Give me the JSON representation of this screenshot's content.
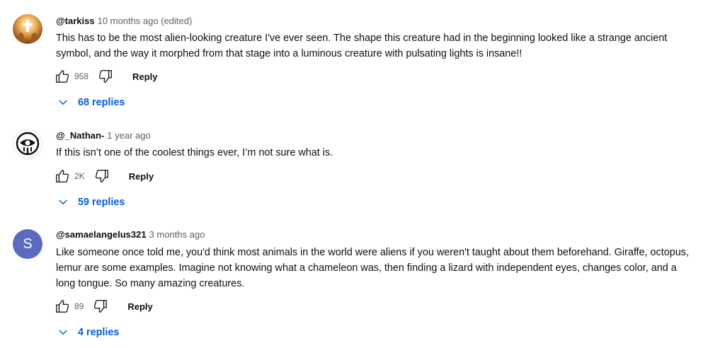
{
  "comments": [
    {
      "author": "@tarkiss",
      "time": "10 months ago (edited)",
      "text": "This has to be the most alien-looking creature I've ever seen. The shape this creature had in the beginning looked like a strange ancient symbol, and the way it morphed from that stage into a luminous creature with pulsating lights is insane!!",
      "likes": "958",
      "reply_label": "Reply",
      "replies_label": "68 replies"
    },
    {
      "author": "@_Nathan-",
      "time": "1 year ago",
      "text": "If this isn’t one of the coolest things ever, I’m not sure what is.",
      "likes": "2K",
      "reply_label": "Reply",
      "replies_label": "59 replies"
    },
    {
      "author": "@samaelangelus321",
      "time": "3 months ago",
      "avatar_letter": "S",
      "text": "Like someone once told me, you'd think most animals in the world were aliens if you weren't taught about them beforehand. Giraffe, octopus, lemur are some examples. Imagine not knowing what a chameleon was, then finding a lizard with independent eyes, changes color, and a long tongue. So many amazing creatures.",
      "likes": "89",
      "reply_label": "Reply",
      "replies_label": "4 replies"
    }
  ],
  "colors": {
    "link_blue": "#065fd4",
    "avatar_purple": "#5c6bc0",
    "meta_gray": "#606060"
  },
  "icons": [
    "thumbs-up-icon",
    "thumbs-down-icon",
    "chevron-down-icon",
    "hands-cross-avatar",
    "eye-symbol-avatar"
  ]
}
